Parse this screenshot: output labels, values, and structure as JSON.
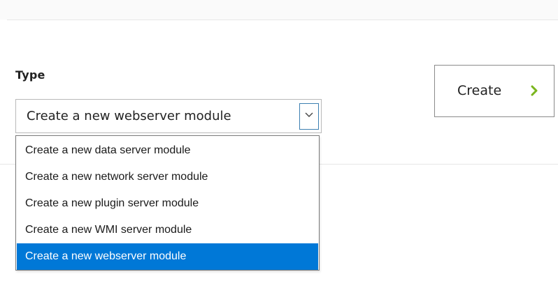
{
  "form": {
    "type_label": "Type",
    "select": {
      "selected_value": "Create a new webserver module",
      "options": [
        {
          "label": "Create a new data server module",
          "selected": false
        },
        {
          "label": "Create a new network server module",
          "selected": false
        },
        {
          "label": "Create a new plugin server module",
          "selected": false
        },
        {
          "label": "Create a new WMI server module",
          "selected": false
        },
        {
          "label": "Create a new webserver module",
          "selected": true
        }
      ]
    },
    "create_button": {
      "label": "Create",
      "icon": "chevron-right-icon"
    }
  },
  "colors": {
    "accent": "#0078d7",
    "chevron": "#7ab51d",
    "select_arrow_border": "#3c7fb1"
  }
}
